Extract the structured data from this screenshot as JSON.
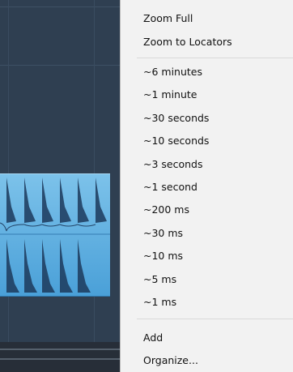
{
  "menu": {
    "items": [
      {
        "label": "Zoom Full"
      },
      {
        "label": "Zoom to Locators"
      },
      {
        "label": "~6 minutes"
      },
      {
        "label": "~1 minute"
      },
      {
        "label": "~30 seconds"
      },
      {
        "label": "~10 seconds"
      },
      {
        "label": "~3 seconds"
      },
      {
        "label": "~1 second"
      },
      {
        "label": "~200 ms"
      },
      {
        "label": "~30 ms"
      },
      {
        "label": "~10 ms"
      },
      {
        "label": "~5 ms"
      },
      {
        "label": "~1 ms"
      },
      {
        "label": "Add"
      },
      {
        "label": "Organize..."
      }
    ]
  },
  "colors": {
    "panel_bg": "#2f3f51",
    "clip_fill": "#5aaee0",
    "waveform": "#1d3a5c",
    "menu_bg": "#f2f2f2"
  }
}
